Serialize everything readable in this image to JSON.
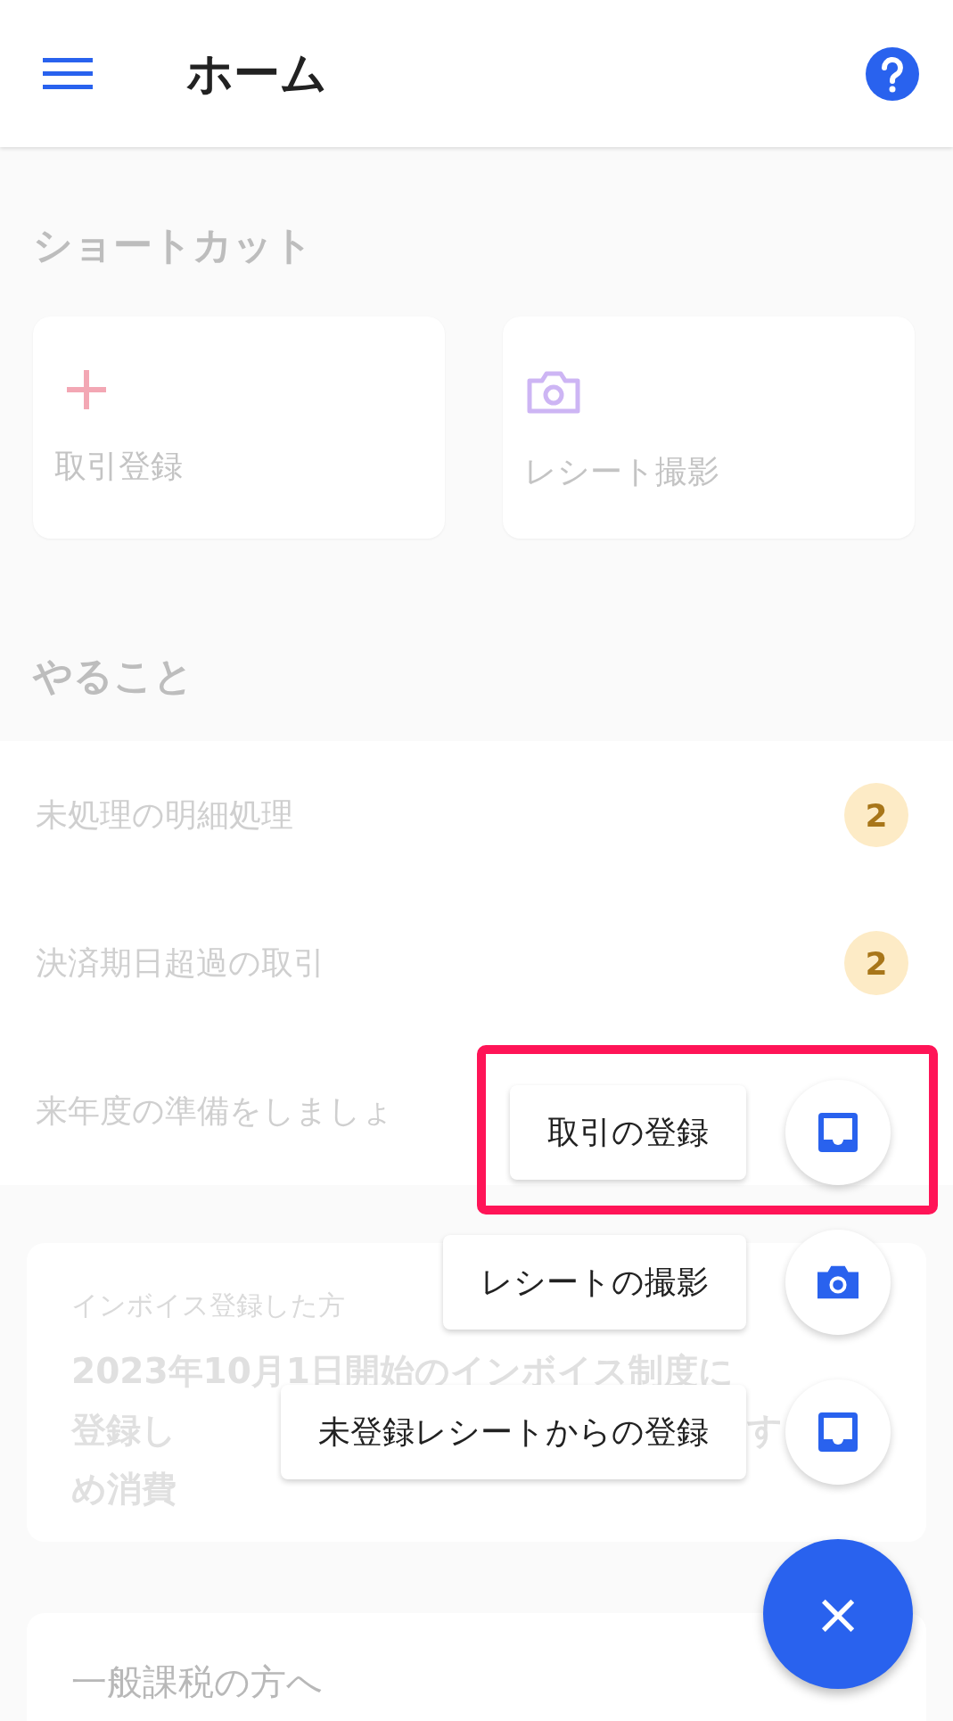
{
  "header": {
    "title": "ホーム"
  },
  "shortcuts": {
    "heading": "ショートカット",
    "items": [
      {
        "kind": "plus",
        "label": "取引登録"
      },
      {
        "kind": "camera",
        "label": "レシート撮影"
      }
    ]
  },
  "todo": {
    "heading": "やること",
    "items": [
      {
        "label": "未処理の明細処理",
        "count": "2"
      },
      {
        "label": "決済期日超過の取引",
        "count": "2"
      },
      {
        "label": "来年度の準備をしましょ"
      }
    ]
  },
  "notice": {
    "caption": "インボイス登録した方",
    "lines": [
      {
        "left": "2023年10月1日開始のインボイス制度に"
      },
      {
        "left": "登録し",
        "right": "す"
      },
      {
        "left": "め消費"
      }
    ]
  },
  "notice2": {
    "title": "一般課税の方へ"
  },
  "speed_dial": {
    "actions": [
      {
        "kind": "tray",
        "label": "取引の登録",
        "highlighted": true
      },
      {
        "kind": "camera",
        "label": "レシートの撮影",
        "highlighted": false
      },
      {
        "kind": "tray",
        "label": "未登録レシートからの登録",
        "highlighted": false
      }
    ],
    "close": "×"
  }
}
